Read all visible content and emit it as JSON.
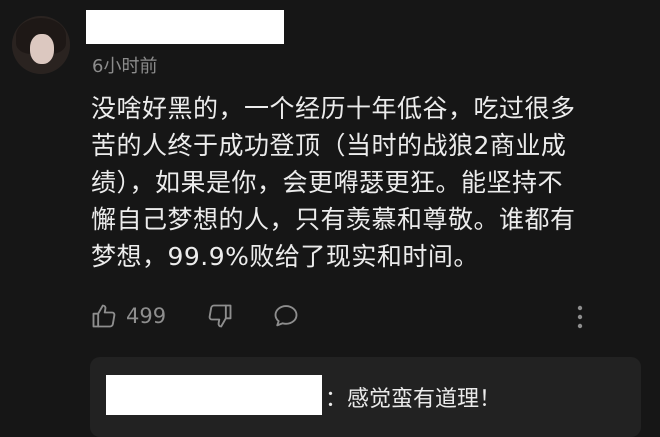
{
  "comment": {
    "time_ago": "6小时前",
    "text": "没啥好黑的，一个经历十年低谷，吃过很多\n苦的人终于成功登顶（当时的战狼2商业成\n绩），如果是你，会更嘚瑟更狂。能坚持不\n懈自己梦想的人，只有羡慕和尊敬。谁都有\n梦想，99.9%败给了现实和时间。",
    "likes": "499"
  },
  "reply": {
    "text": "：感觉蛮有道理！"
  },
  "colors": {
    "background": "#161616",
    "reply_background": "#222222",
    "muted": "#8c8c8c"
  },
  "icons": [
    "thumbs-up-icon",
    "thumbs-down-icon",
    "comment-bubble-icon",
    "more-vertical-icon"
  ]
}
